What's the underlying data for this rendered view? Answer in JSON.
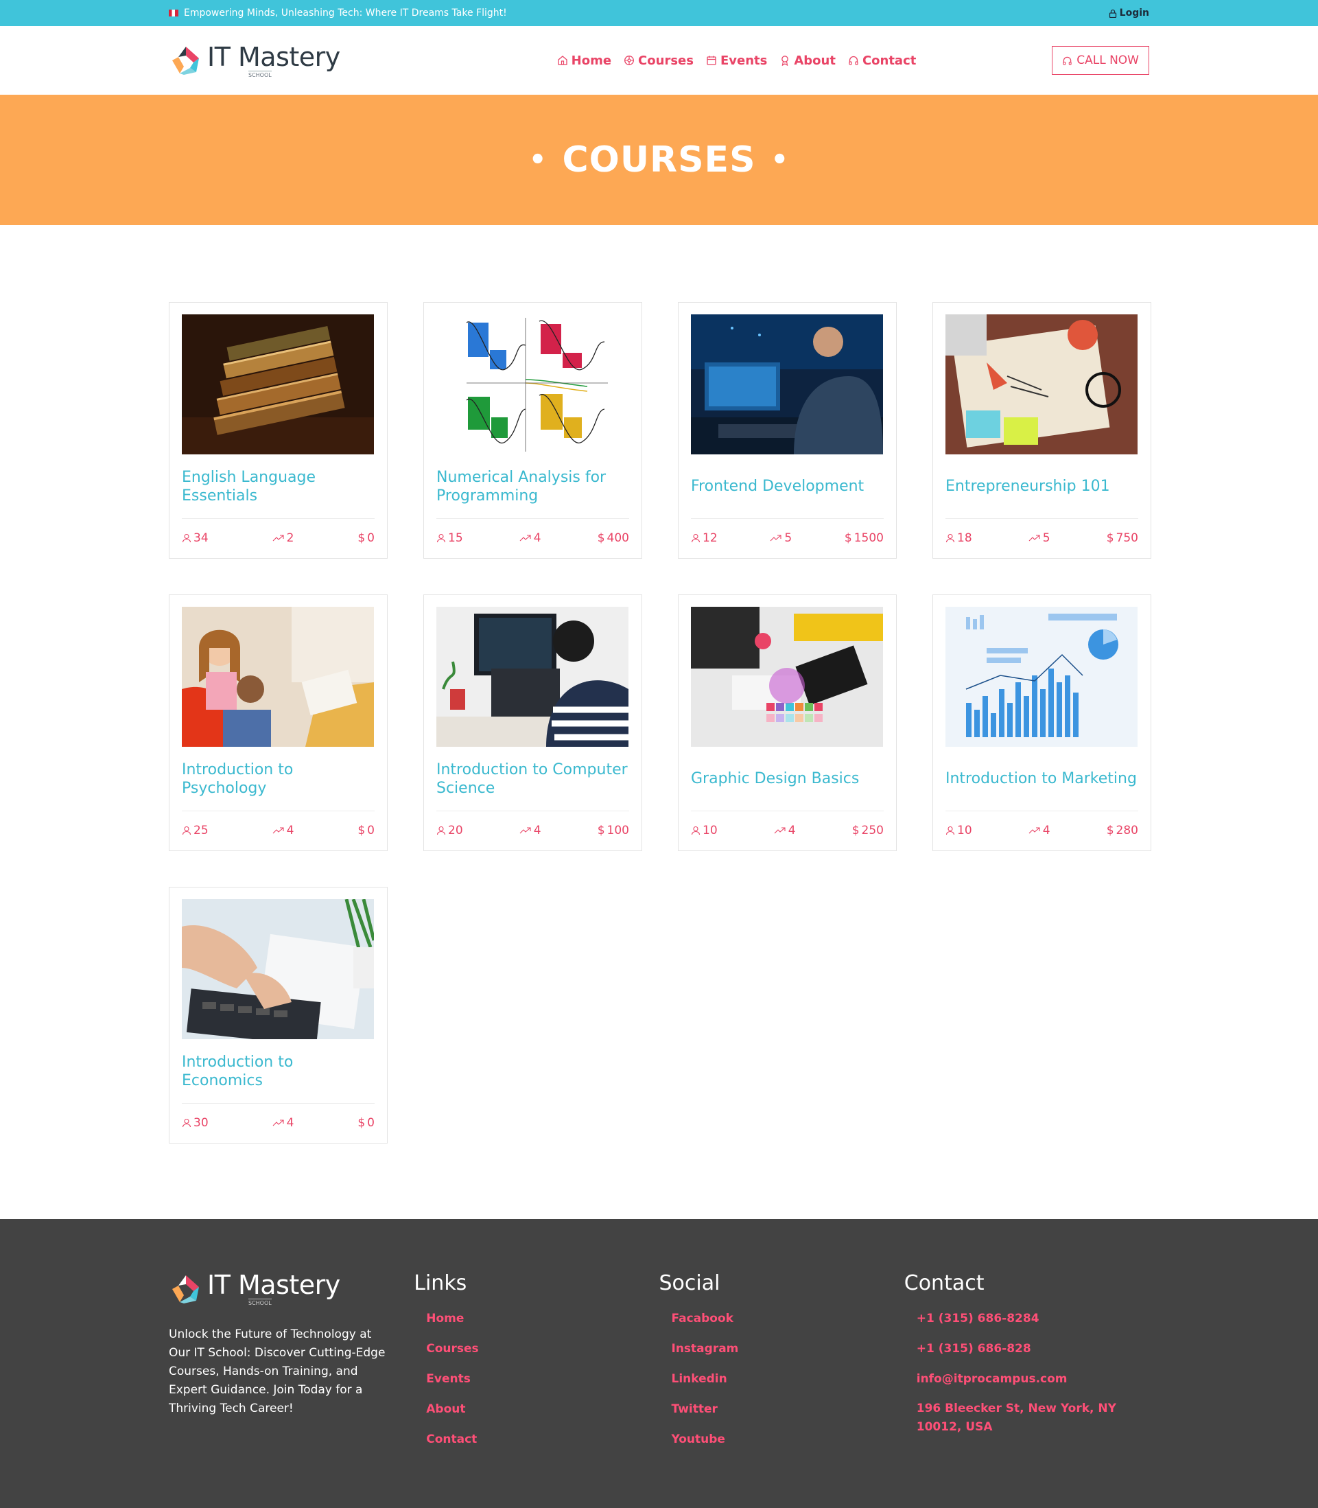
{
  "topbar": {
    "tagline": "Empowering Minds, Unleashing Tech: Where IT Dreams Take Flight!",
    "login": "Login"
  },
  "brand": {
    "name": "IT Mastery",
    "sub": "SCHOOL"
  },
  "nav": {
    "home": "Home",
    "courses": "Courses",
    "events": "Events",
    "about": "About",
    "contact": "Contact",
    "call": "CALL NOW"
  },
  "hero": {
    "title": "COURSES"
  },
  "courses": [
    {
      "title": "English Language Essentials",
      "students": "34",
      "lessons": "2",
      "price": "0",
      "image": "stacked-books"
    },
    {
      "title": "Numerical Analysis for Programming",
      "students": "15",
      "lessons": "4",
      "price": "400",
      "image": "numerical-graphs"
    },
    {
      "title": "Frontend Development",
      "students": "12",
      "lessons": "5",
      "price": "1500",
      "image": "developer-at-monitors"
    },
    {
      "title": "Entrepreneurship 101",
      "students": "18",
      "lessons": "5",
      "price": "750",
      "image": "startup-desk"
    },
    {
      "title": "Introduction to Psychology",
      "students": "25",
      "lessons": "4",
      "price": "0",
      "image": "child-therapy-session"
    },
    {
      "title": "Introduction to Computer Science",
      "students": "20",
      "lessons": "4",
      "price": "100",
      "image": "boy-coding"
    },
    {
      "title": "Graphic Design Basics",
      "students": "10",
      "lessons": "4",
      "price": "250",
      "image": "color-swatches"
    },
    {
      "title": "Introduction to Marketing",
      "students": "10",
      "lessons": "4",
      "price": "280",
      "image": "bar-chart-report"
    },
    {
      "title": "Introduction to Economics",
      "students": "30",
      "lessons": "4",
      "price": "0",
      "image": "calculator-hands"
    }
  ],
  "currency": "$",
  "footer": {
    "description": "Unlock the Future of Technology at Our IT School: Discover Cutting-Edge Courses, Hands-on Training, and Expert Guidance. Join Today for a Thriving Tech Career!",
    "links_title": "Links",
    "links": [
      "Home",
      "Courses",
      "Events",
      "About",
      "Contact"
    ],
    "social_title": "Social",
    "social": [
      "Facabook",
      "Instagram",
      "Linkedin",
      "Twitter",
      "Youtube"
    ],
    "contact_title": "Contact",
    "phone1": "+1 (315) 686-8284",
    "phone2": "+1 (315) 686-828",
    "email": "info@itprocampus.com",
    "address": "196 Bleecker St, New York, NY 10012, USA"
  },
  "colors": {
    "accent": "#e94466",
    "teal": "#40c4da",
    "hero": "#fda854",
    "footer": "#434343"
  }
}
